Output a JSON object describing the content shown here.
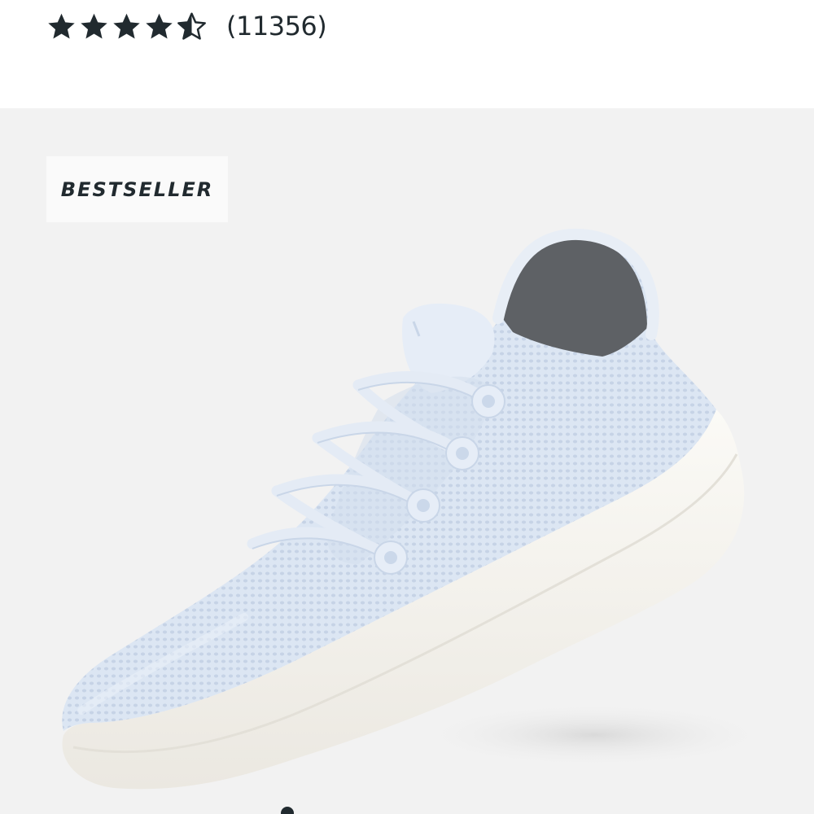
{
  "rating": {
    "value": 4.5,
    "max": 5,
    "count_label": "(11356)",
    "star_color": "#212a2f",
    "star_icons": [
      "star-full-icon",
      "star-full-icon",
      "star-full-icon",
      "star-full-icon",
      "star-half-icon"
    ]
  },
  "product": {
    "badge_label": "BESTSELLER",
    "media_background": "#f2f2f2",
    "shoe_upper_color": "#dce6f3",
    "shoe_sole_color": "#f8f6f1"
  },
  "carousel": {
    "active_index": 0
  }
}
